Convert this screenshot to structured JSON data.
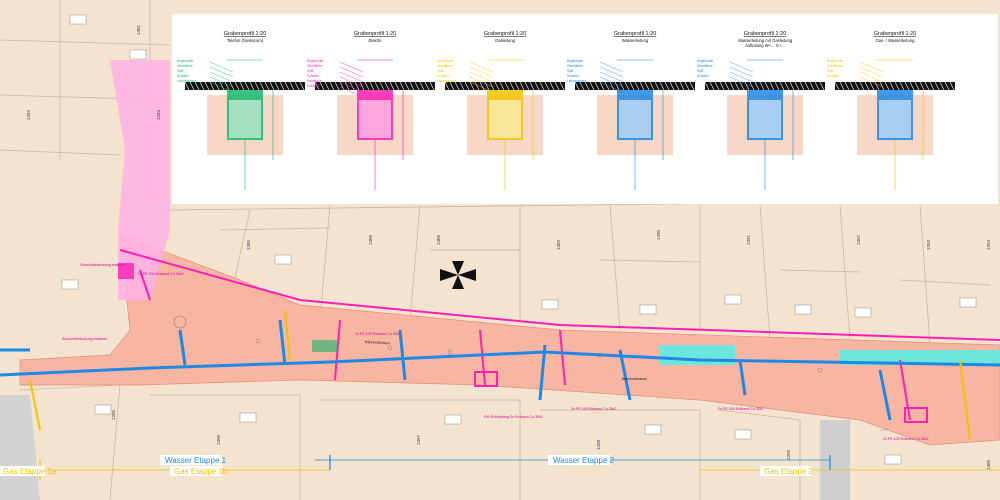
{
  "colors": {
    "parcel": "#f3e3cf",
    "parcel_line": "#cdb79e",
    "street": "#f7b5a2",
    "street_dots": "#e08f7e",
    "pink": "#ff1fb4",
    "pink_fill": "#ffb1e6",
    "blue": "#1e88e5",
    "cyan": "#6ce6dd",
    "yellow": "#f2c400",
    "green": "#14b86c",
    "grey_area": "#d0d0d0",
    "panel": "#ffffff"
  },
  "profiles": [
    {
      "title": "Grabenprofil 1:20",
      "subtitle": "Telefon (Swisscom)",
      "color": "#14b86c",
      "fill": "#14b86c",
      "notes": [
        "Begehstufe",
        "Oberfläche",
        "Split",
        "Schotter",
        "Leitungszone"
      ]
    },
    {
      "title": "Grabenprofil 1:20",
      "subtitle": "Elektro",
      "color": "#ff1fb4",
      "fill": "#ff1fb4",
      "notes": [
        "Begehstufe",
        "Oberfläche",
        "Split",
        "Schotter",
        "Rohrblock",
        "Erdband"
      ]
    },
    {
      "title": "Grabenprofil 1:20",
      "subtitle": "Gasleitung",
      "color": "#f2c400",
      "fill": "#f2c400",
      "notes": [
        "Begehstufe",
        "Oberfläche",
        "Split",
        "Schotter",
        "Leitungszone"
      ]
    },
    {
      "title": "Grabenprofil 1:20",
      "subtitle": "Wasserleitung",
      "color": "#1e88e5",
      "fill": "#1e88e5",
      "notes": [
        "Begehstufe",
        "Oberfläche",
        "Split",
        "Schotter",
        "Leitungszone"
      ]
    },
    {
      "title": "Grabenprofil 1:20",
      "subtitle": "Wasserleitung mit Gasleitung\nAufteilung W+... G+...",
      "color": "#1e88e5",
      "fill": "#1e88e5",
      "notes": [
        "Begehstufe",
        "Oberfläche",
        "Split",
        "Schotter"
      ]
    },
    {
      "title": "Grabenprofil 1:20",
      "subtitle": "Gas- / Wasserleitung",
      "color": "#f2c400",
      "fill": "#1e88e5",
      "notes": [
        "Begehstufe",
        "Oberfläche",
        "Split",
        "Schotter"
      ]
    }
  ],
  "stages": [
    {
      "label": "Gas Etappe 1a",
      "color": "#f2c400"
    },
    {
      "label": "Gas Etappe 1b",
      "color": "#f2c400"
    },
    {
      "label": "Wasser Etappe 1",
      "color": "#1e88e5"
    },
    {
      "label": "Wasser Etappe 2",
      "color": "#1e88e5"
    },
    {
      "label": "Gas Etappe 2",
      "color": "#f2c400"
    }
  ],
  "street_names": [
    "Bahnhofstrasse",
    "Bahnhofstrasse"
  ],
  "annotations": [
    "Schachtabdeckung ersetzen",
    "Schachtabdeckung ersetzen",
    "2x PE 100 Erdband Cu 35x2",
    "2x PE 100 Erdband Cu 35x2",
    "2x PE 100 Erdband Cu 35x2",
    "2x PE 100 Erdband Cu 35x2",
    "EW Rohrleitung 2x Erdband Cu 35x2",
    "2x PE 100 Erdband Cu 35x2"
  ],
  "parcel_numbers": [
    "1381",
    "1383",
    "1384",
    "1385",
    "1386",
    "1388",
    "1389",
    "1390",
    "1391",
    "1392",
    "1393",
    "1394",
    "1395",
    "1396",
    "1397",
    "1398",
    "1399",
    "1400"
  ]
}
